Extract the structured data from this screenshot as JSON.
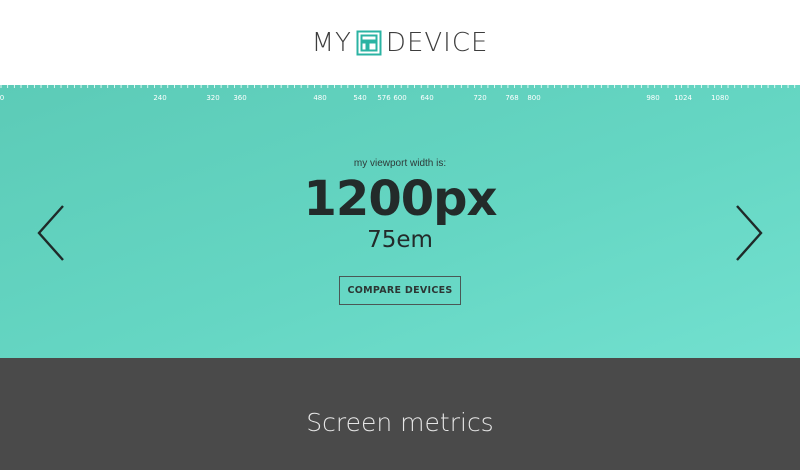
{
  "header": {
    "logo_left": "MY",
    "logo_right": "DEVICE",
    "logo_icon": "device-square-icon",
    "logo_color": "#2bb3a3"
  },
  "ruler": {
    "labels": [
      "0",
      "240",
      "320",
      "360",
      "480",
      "540",
      "576",
      "600",
      "640",
      "720",
      "768",
      "800",
      "980",
      "1024",
      "1080"
    ]
  },
  "hero": {
    "caption": "my viewport width is:",
    "width_px": "1200px",
    "width_em": "75em",
    "compare_button": "COMPARE DEVICES",
    "prev_icon": "chevron-left-icon",
    "next_icon": "chevron-right-icon",
    "accent": "#65d6c3"
  },
  "metrics": {
    "title": "Screen metrics",
    "background": "#4a4a4a"
  }
}
